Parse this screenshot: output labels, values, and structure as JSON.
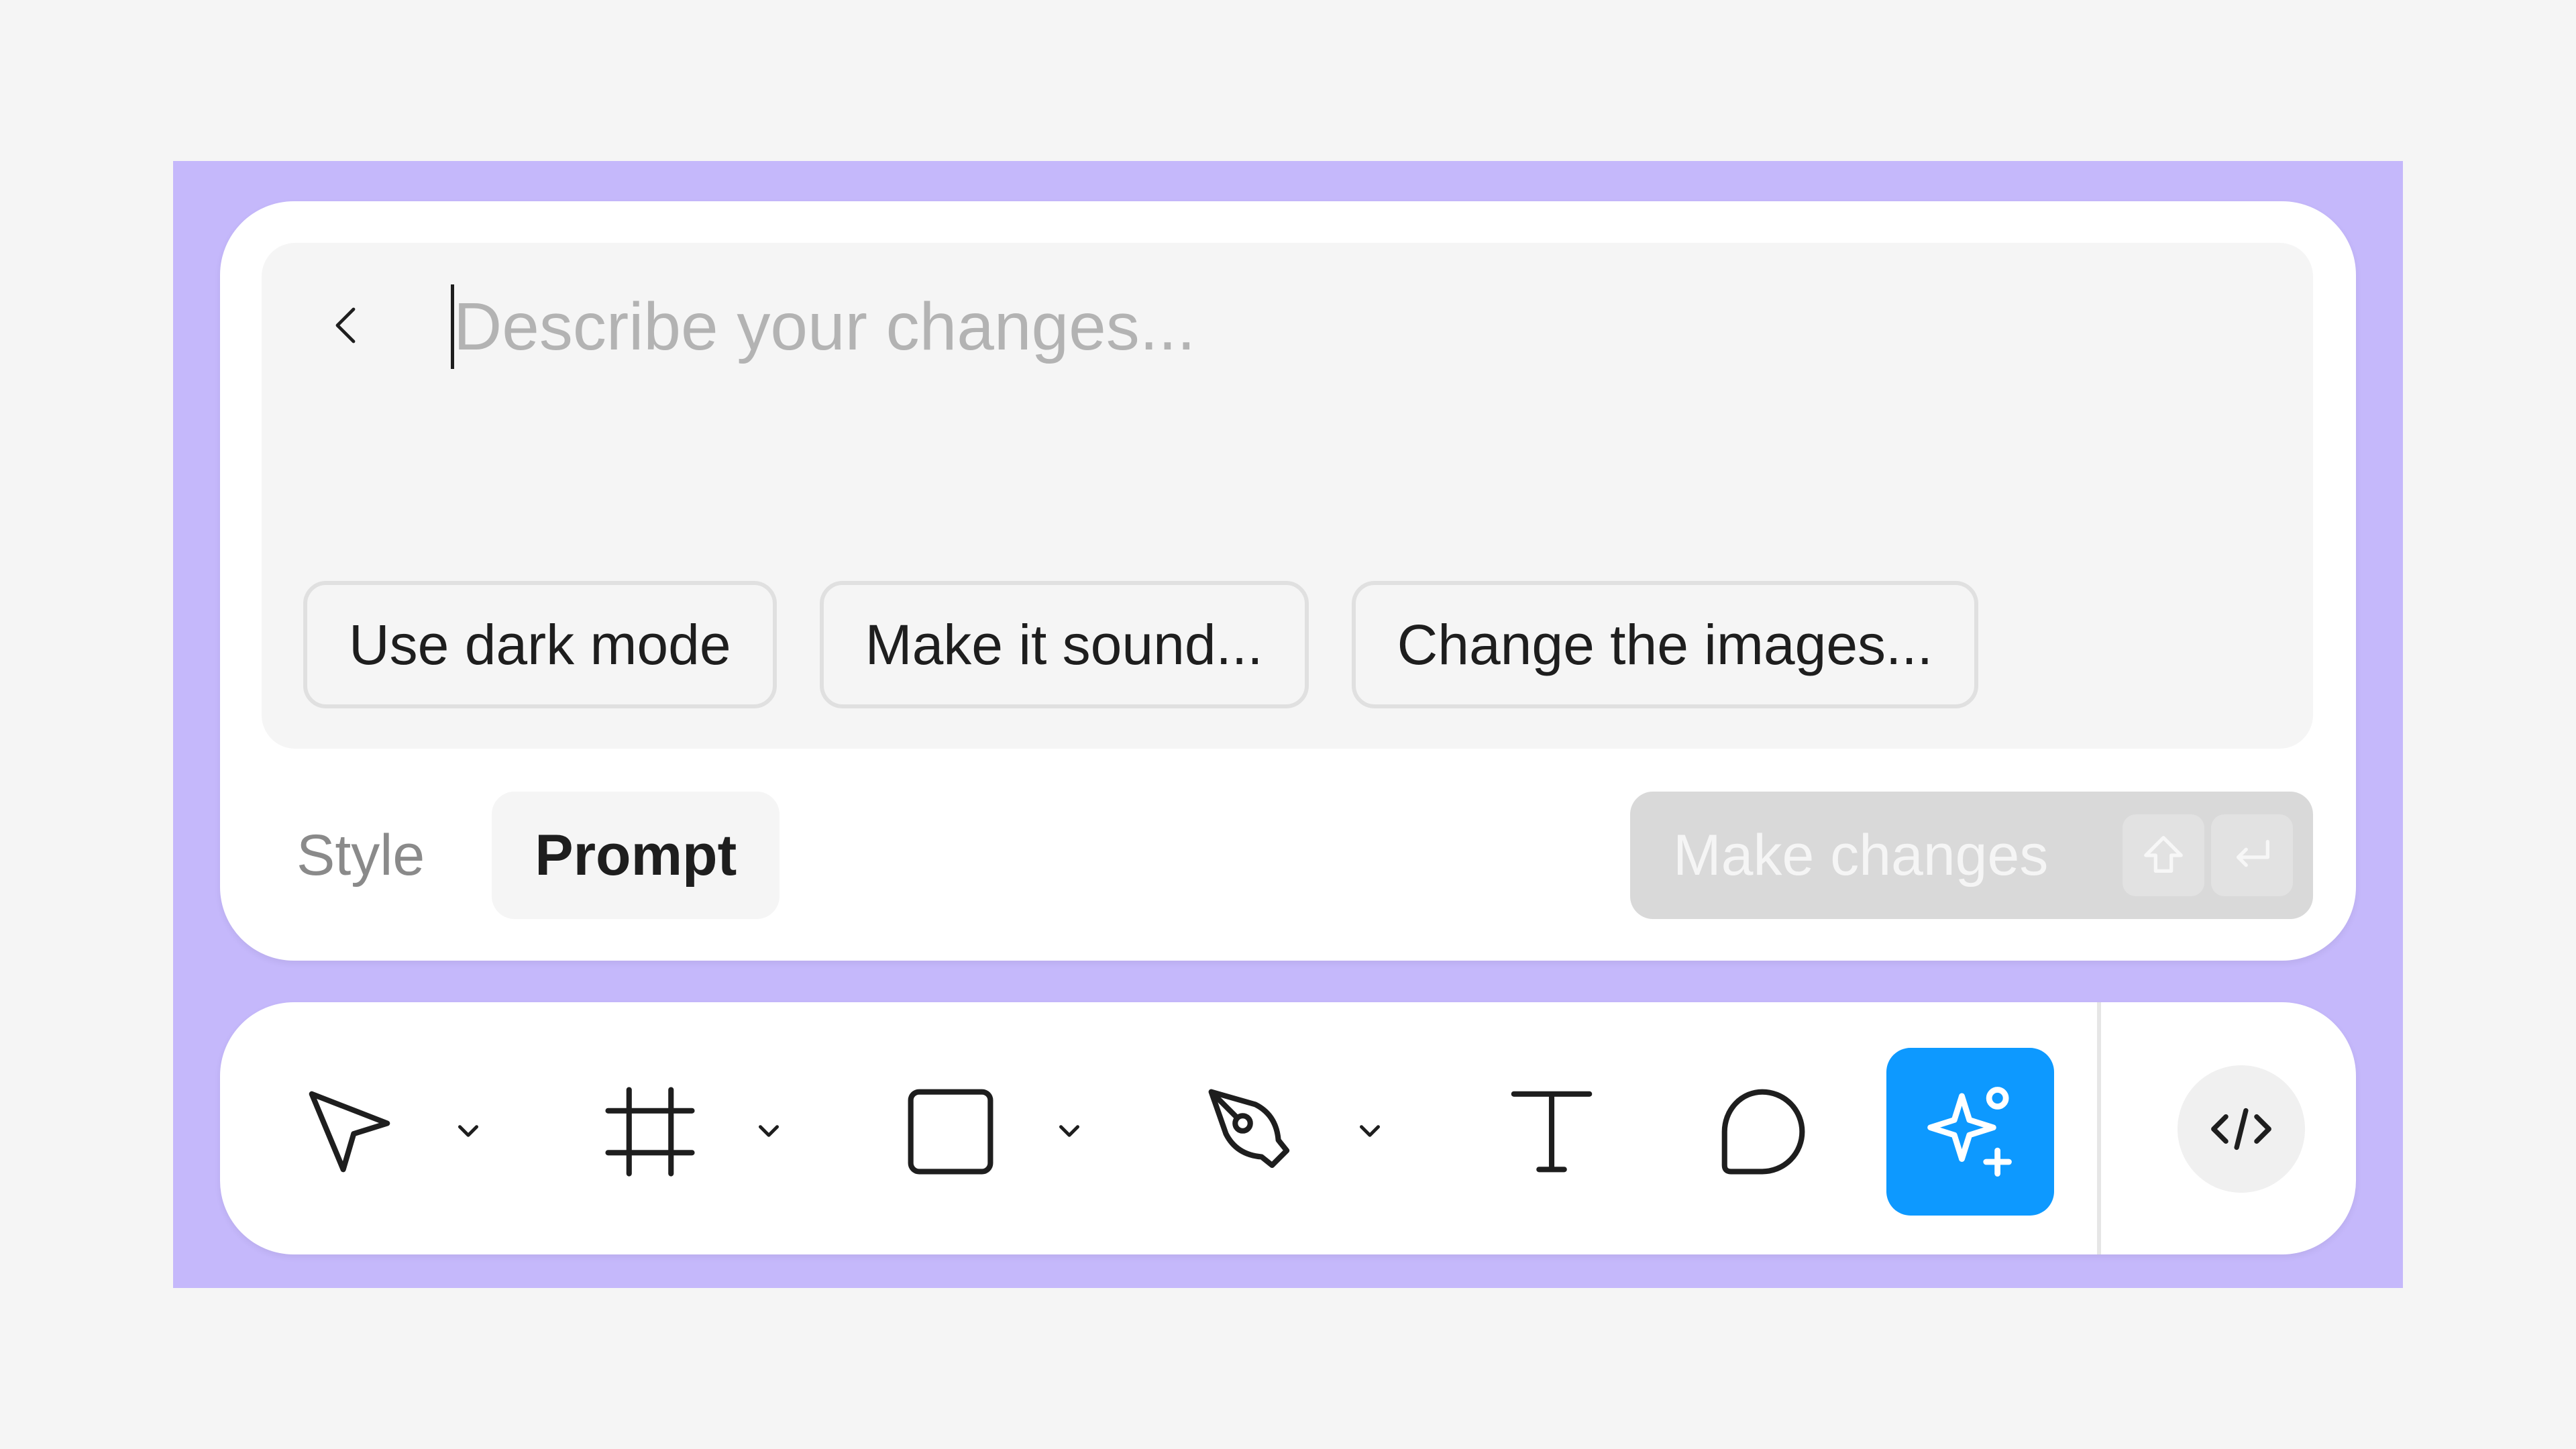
{
  "prompt": {
    "placeholder": "Describe your changes...",
    "value": ""
  },
  "suggestions": [
    {
      "label": "Use dark mode"
    },
    {
      "label": "Make it sound..."
    },
    {
      "label": "Change the images..."
    }
  ],
  "tabs": [
    {
      "label": "Style",
      "active": false
    },
    {
      "label": "Prompt",
      "active": true
    }
  ],
  "submit": {
    "label": "Make changes",
    "shortcut_icons": [
      "shift-icon",
      "enter-icon"
    ]
  },
  "toolbar": {
    "tools": [
      {
        "icon": "move-cursor-icon",
        "has_menu": true
      },
      {
        "icon": "frame-icon",
        "has_menu": true
      },
      {
        "icon": "rectangle-icon",
        "has_menu": true
      },
      {
        "icon": "pen-icon",
        "has_menu": true
      },
      {
        "icon": "text-icon",
        "has_menu": false
      },
      {
        "icon": "comment-icon",
        "has_menu": false
      },
      {
        "icon": "ai-sparkle-icon",
        "has_menu": false,
        "active": true
      }
    ],
    "extra": {
      "icon": "code-icon"
    }
  },
  "colors": {
    "backdrop": "#c5b8fb",
    "accent": "#0d99ff",
    "panel": "#ffffff",
    "surface": "#f5f5f5"
  }
}
